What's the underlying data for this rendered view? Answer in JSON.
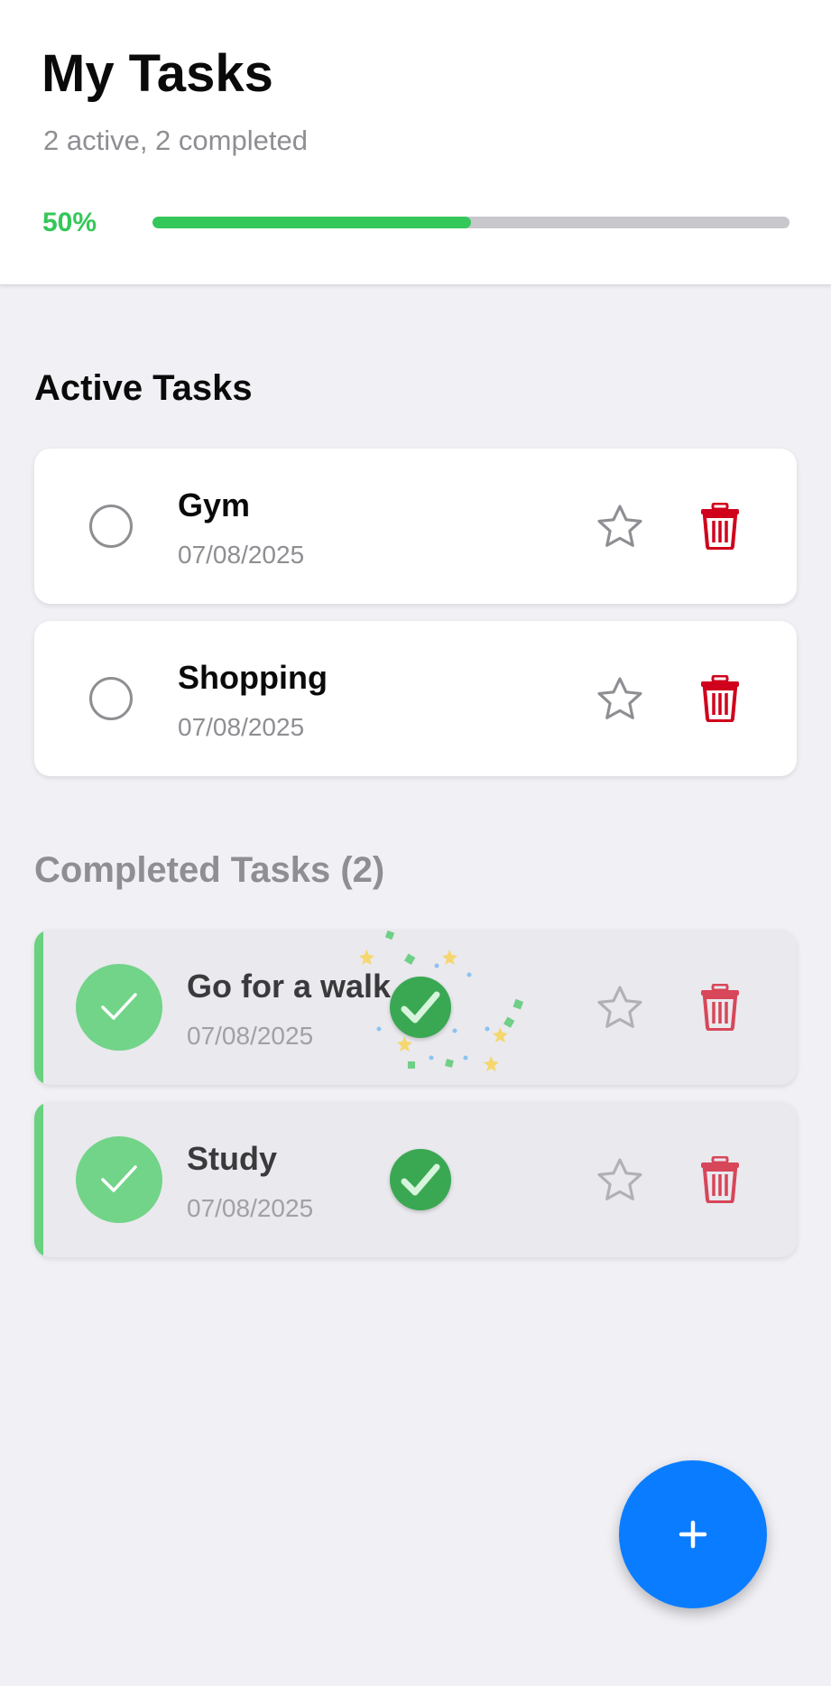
{
  "header": {
    "title": "My Tasks",
    "subtitle": "2 active, 2 completed",
    "progress_label": "50%",
    "progress_value": 0.5
  },
  "active_section": {
    "title": "Active Tasks",
    "tasks": [
      {
        "name": "Gym",
        "date": "07/08/2025"
      },
      {
        "name": "Shopping",
        "date": "07/08/2025"
      }
    ]
  },
  "completed_section": {
    "title": "Completed Tasks (2)",
    "tasks": [
      {
        "name": "Go for a walk",
        "date": "07/08/2025"
      },
      {
        "name": "Study",
        "date": "07/08/2025"
      }
    ]
  },
  "colors": {
    "accent_green": "#34c759",
    "delete_red": "#d0021b",
    "fab_blue": "#0a7cff"
  },
  "icons": {
    "star": "star-outline-icon",
    "delete": "trash-icon",
    "add": "plus-icon",
    "check": "checkmark-icon"
  }
}
